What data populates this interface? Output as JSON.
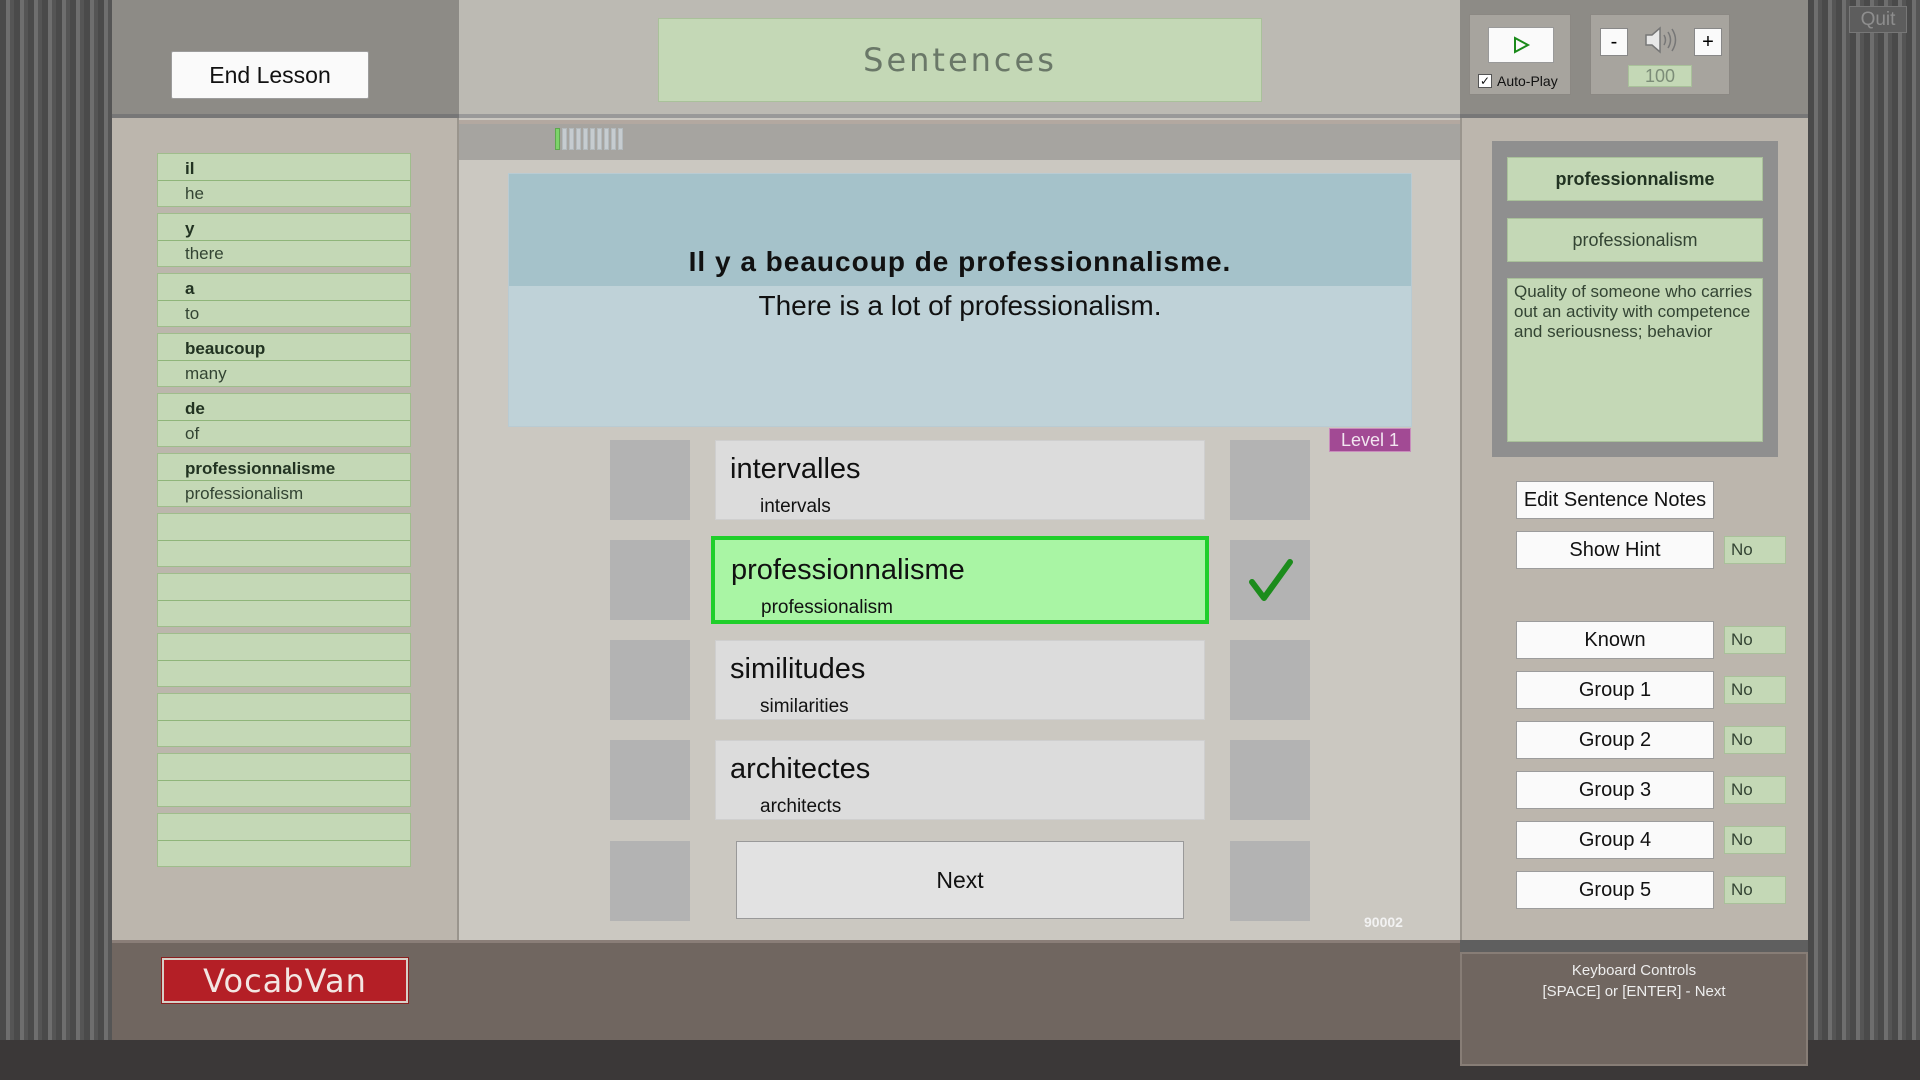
{
  "header": {
    "end_lesson_label": "End Lesson",
    "title": "Sentences",
    "quit_label": "Quit"
  },
  "audio": {
    "autoplay_label": "Auto-Play",
    "autoplay_checked": true,
    "checkmark": "✓",
    "volume_minus": "-",
    "volume_plus": "+",
    "volume_value": "100",
    "play_icon": "play-icon",
    "speaker_icon": "speaker-icon"
  },
  "word_list": [
    {
      "word": "il",
      "translation": "he"
    },
    {
      "word": "y",
      "translation": "there"
    },
    {
      "word": "a",
      "translation": "to"
    },
    {
      "word": "beaucoup",
      "translation": "many"
    },
    {
      "word": "de",
      "translation": "of"
    },
    {
      "word": "professionnalisme",
      "translation": "professionalism"
    },
    {
      "word": "",
      "translation": ""
    },
    {
      "word": "",
      "translation": ""
    },
    {
      "word": "",
      "translation": ""
    },
    {
      "word": "",
      "translation": ""
    },
    {
      "word": "",
      "translation": ""
    },
    {
      "word": "",
      "translation": ""
    }
  ],
  "progress": {
    "completed": 1,
    "total": 10
  },
  "sentence": {
    "french": "Il y a beaucoup de professionnalisme.",
    "english": "There is a lot of professionalism.",
    "level": "Level 1"
  },
  "answers": [
    {
      "word": "intervalles",
      "translation": "intervals",
      "correct": false
    },
    {
      "word": "professionnalisme",
      "translation": "professionalism",
      "correct": true
    },
    {
      "word": "similitudes",
      "translation": "similarities",
      "correct": false
    },
    {
      "word": "architectes",
      "translation": "architects",
      "correct": false
    }
  ],
  "next_label": "Next",
  "session_id": "90002",
  "detail": {
    "word": "professionnalisme",
    "translation": "professionalism",
    "definition": "Quality of someone who carries out an activity with competence and seriousness; behavior"
  },
  "right_buttons": {
    "edit_notes": "Edit Sentence Notes",
    "show_hint": "Show Hint",
    "show_hint_value": "No",
    "known": "Known",
    "known_value": "No",
    "groups": [
      {
        "label": "Group 1",
        "value": "No"
      },
      {
        "label": "Group 2",
        "value": "No"
      },
      {
        "label": "Group 3",
        "value": "No"
      },
      {
        "label": "Group 4",
        "value": "No"
      },
      {
        "label": "Group 5",
        "value": "No"
      }
    ]
  },
  "footer": {
    "logo": "VocabVan",
    "keyboard_title": "Keyboard Controls",
    "keyboard_hint": "[SPACE] or [ENTER] - Next"
  },
  "colors": {
    "correct_border": "#1fcf2a",
    "correct_fill": "#a9f5a4",
    "panel_green": "#c4d8b6",
    "logo_red": "#b41f26",
    "level_purple": "#a24a94"
  }
}
